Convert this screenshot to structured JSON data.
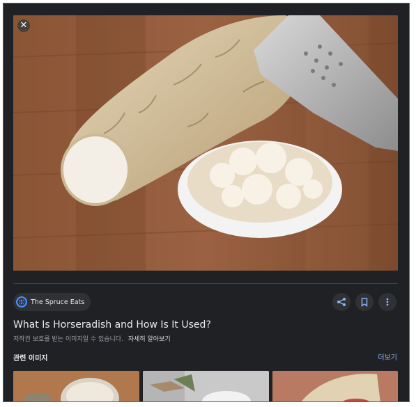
{
  "viewer": {
    "close_icon": "close-icon",
    "image_alt": "Horseradish root with grater and bowl of grated horseradish"
  },
  "source": {
    "name": "The Spruce Eats",
    "icon": "globe-icon"
  },
  "actions": {
    "share_icon": "share-icon",
    "save_icon": "bookmark-icon",
    "more_icon": "more-vert-icon"
  },
  "details": {
    "title": "What Is Horseradish and How Is It Used?",
    "copyright_notice": "저작권 보호를 받는 이미지일 수 있습니다.",
    "learn_more": "자세히 알아보기"
  },
  "related": {
    "label": "관련 이미지",
    "more_label": "더보기"
  },
  "colors": {
    "background": "#202124",
    "link": "#8ab4f8",
    "chip": "#303134",
    "text": "#e8eaed"
  }
}
